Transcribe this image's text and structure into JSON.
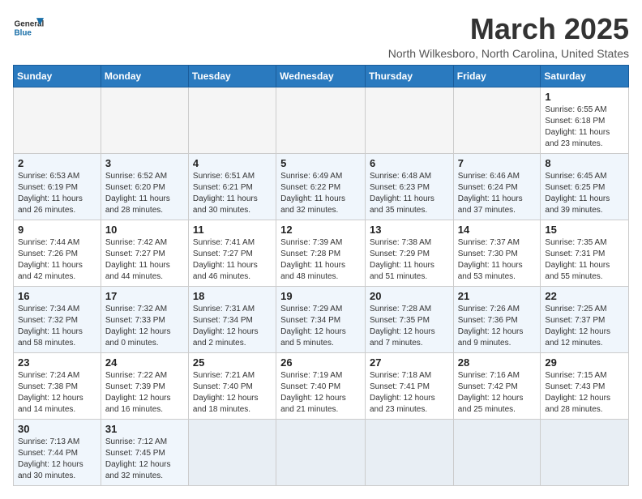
{
  "header": {
    "logo_text_general": "General",
    "logo_text_blue": "Blue",
    "month_year": "March 2025",
    "location": "North Wilkesboro, North Carolina, United States"
  },
  "days_of_week": [
    "Sunday",
    "Monday",
    "Tuesday",
    "Wednesday",
    "Thursday",
    "Friday",
    "Saturday"
  ],
  "weeks": [
    [
      {
        "day": "",
        "info": ""
      },
      {
        "day": "",
        "info": ""
      },
      {
        "day": "",
        "info": ""
      },
      {
        "day": "",
        "info": ""
      },
      {
        "day": "",
        "info": ""
      },
      {
        "day": "",
        "info": ""
      },
      {
        "day": "1",
        "info": "Sunrise: 6:55 AM\nSunset: 6:18 PM\nDaylight: 11 hours\nand 23 minutes."
      }
    ],
    [
      {
        "day": "2",
        "info": "Sunrise: 6:53 AM\nSunset: 6:19 PM\nDaylight: 11 hours\nand 26 minutes."
      },
      {
        "day": "3",
        "info": "Sunrise: 6:52 AM\nSunset: 6:20 PM\nDaylight: 11 hours\nand 28 minutes."
      },
      {
        "day": "4",
        "info": "Sunrise: 6:51 AM\nSunset: 6:21 PM\nDaylight: 11 hours\nand 30 minutes."
      },
      {
        "day": "5",
        "info": "Sunrise: 6:49 AM\nSunset: 6:22 PM\nDaylight: 11 hours\nand 32 minutes."
      },
      {
        "day": "6",
        "info": "Sunrise: 6:48 AM\nSunset: 6:23 PM\nDaylight: 11 hours\nand 35 minutes."
      },
      {
        "day": "7",
        "info": "Sunrise: 6:46 AM\nSunset: 6:24 PM\nDaylight: 11 hours\nand 37 minutes."
      },
      {
        "day": "8",
        "info": "Sunrise: 6:45 AM\nSunset: 6:25 PM\nDaylight: 11 hours\nand 39 minutes."
      }
    ],
    [
      {
        "day": "9",
        "info": "Sunrise: 7:44 AM\nSunset: 7:26 PM\nDaylight: 11 hours\nand 42 minutes."
      },
      {
        "day": "10",
        "info": "Sunrise: 7:42 AM\nSunset: 7:27 PM\nDaylight: 11 hours\nand 44 minutes."
      },
      {
        "day": "11",
        "info": "Sunrise: 7:41 AM\nSunset: 7:27 PM\nDaylight: 11 hours\nand 46 minutes."
      },
      {
        "day": "12",
        "info": "Sunrise: 7:39 AM\nSunset: 7:28 PM\nDaylight: 11 hours\nand 48 minutes."
      },
      {
        "day": "13",
        "info": "Sunrise: 7:38 AM\nSunset: 7:29 PM\nDaylight: 11 hours\nand 51 minutes."
      },
      {
        "day": "14",
        "info": "Sunrise: 7:37 AM\nSunset: 7:30 PM\nDaylight: 11 hours\nand 53 minutes."
      },
      {
        "day": "15",
        "info": "Sunrise: 7:35 AM\nSunset: 7:31 PM\nDaylight: 11 hours\nand 55 minutes."
      }
    ],
    [
      {
        "day": "16",
        "info": "Sunrise: 7:34 AM\nSunset: 7:32 PM\nDaylight: 11 hours\nand 58 minutes."
      },
      {
        "day": "17",
        "info": "Sunrise: 7:32 AM\nSunset: 7:33 PM\nDaylight: 12 hours\nand 0 minutes."
      },
      {
        "day": "18",
        "info": "Sunrise: 7:31 AM\nSunset: 7:34 PM\nDaylight: 12 hours\nand 2 minutes."
      },
      {
        "day": "19",
        "info": "Sunrise: 7:29 AM\nSunset: 7:34 PM\nDaylight: 12 hours\nand 5 minutes."
      },
      {
        "day": "20",
        "info": "Sunrise: 7:28 AM\nSunset: 7:35 PM\nDaylight: 12 hours\nand 7 minutes."
      },
      {
        "day": "21",
        "info": "Sunrise: 7:26 AM\nSunset: 7:36 PM\nDaylight: 12 hours\nand 9 minutes."
      },
      {
        "day": "22",
        "info": "Sunrise: 7:25 AM\nSunset: 7:37 PM\nDaylight: 12 hours\nand 12 minutes."
      }
    ],
    [
      {
        "day": "23",
        "info": "Sunrise: 7:24 AM\nSunset: 7:38 PM\nDaylight: 12 hours\nand 14 minutes."
      },
      {
        "day": "24",
        "info": "Sunrise: 7:22 AM\nSunset: 7:39 PM\nDaylight: 12 hours\nand 16 minutes."
      },
      {
        "day": "25",
        "info": "Sunrise: 7:21 AM\nSunset: 7:40 PM\nDaylight: 12 hours\nand 18 minutes."
      },
      {
        "day": "26",
        "info": "Sunrise: 7:19 AM\nSunset: 7:40 PM\nDaylight: 12 hours\nand 21 minutes."
      },
      {
        "day": "27",
        "info": "Sunrise: 7:18 AM\nSunset: 7:41 PM\nDaylight: 12 hours\nand 23 minutes."
      },
      {
        "day": "28",
        "info": "Sunrise: 7:16 AM\nSunset: 7:42 PM\nDaylight: 12 hours\nand 25 minutes."
      },
      {
        "day": "29",
        "info": "Sunrise: 7:15 AM\nSunset: 7:43 PM\nDaylight: 12 hours\nand 28 minutes."
      }
    ],
    [
      {
        "day": "30",
        "info": "Sunrise: 7:13 AM\nSunset: 7:44 PM\nDaylight: 12 hours\nand 30 minutes."
      },
      {
        "day": "31",
        "info": "Sunrise: 7:12 AM\nSunset: 7:45 PM\nDaylight: 12 hours\nand 32 minutes."
      },
      {
        "day": "",
        "info": ""
      },
      {
        "day": "",
        "info": ""
      },
      {
        "day": "",
        "info": ""
      },
      {
        "day": "",
        "info": ""
      },
      {
        "day": "",
        "info": ""
      }
    ]
  ]
}
